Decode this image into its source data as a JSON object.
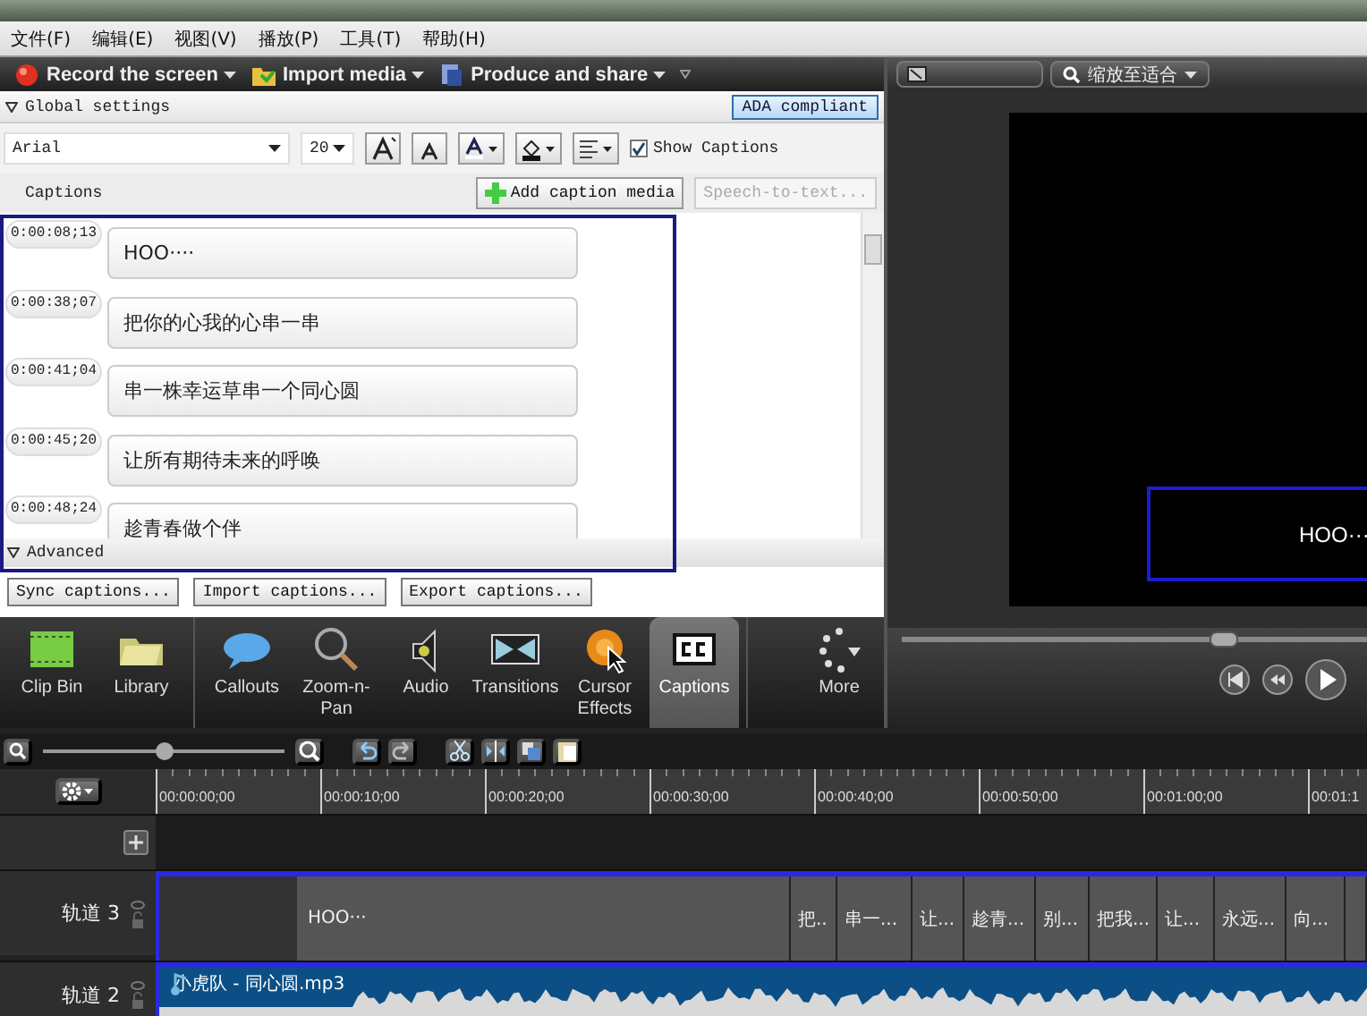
{
  "menu": [
    "文件(F)",
    "编辑(E)",
    "视图(V)",
    "播放(P)",
    "工具(T)",
    "帮助(H)"
  ],
  "toolbar": [
    {
      "label": "Record the screen",
      "kind": "record"
    },
    {
      "label": "Import media",
      "kind": "import"
    },
    {
      "label": "Produce and share",
      "kind": "produce"
    }
  ],
  "caption_panel": {
    "global_settings": "Global settings",
    "ada_button": "ADA compliant",
    "font": "Arial",
    "font_size": "20",
    "show_captions": {
      "label": "Show Captions",
      "checked": true
    },
    "captions_title": "Captions",
    "actions": [
      {
        "label": "Add caption media",
        "disabled": false
      },
      {
        "label": "Speech-to-text...",
        "disabled": true
      }
    ],
    "captions": [
      {
        "time": "0:00:08;13",
        "text": "HOO····"
      },
      {
        "time": "0:00:38;07",
        "text": "把你的心我的心串一串"
      },
      {
        "time": "0:00:41;04",
        "text": "串一株幸运草串一个同心圆"
      },
      {
        "time": "0:00:45;20",
        "text": "让所有期待未来的呼唤"
      },
      {
        "time": "0:00:48;24",
        "text": "趁青春做个伴"
      }
    ],
    "advanced": "Advanced",
    "buttons": [
      "Sync captions...",
      "Import captions...",
      "Export captions..."
    ]
  },
  "tabs": [
    {
      "label": "Clip Bin",
      "kind": "clipbin",
      "selected": false
    },
    {
      "label": "Library",
      "kind": "library",
      "selected": false
    },
    {
      "label": "Callouts",
      "kind": "callouts",
      "selected": false
    },
    {
      "label": "Zoom-n-Pan",
      "kind": "zoom",
      "selected": false
    },
    {
      "label": "Audio",
      "kind": "audio",
      "selected": false
    },
    {
      "label": "Transitions",
      "kind": "transitions",
      "selected": false
    },
    {
      "label": "Cursor Effects",
      "kind": "cursor",
      "selected": false
    },
    {
      "label": "Captions",
      "kind": "captions",
      "selected": true
    },
    {
      "label": "More",
      "kind": "more",
      "selected": false
    }
  ],
  "preview": {
    "zoom_menu": "缩放至适合",
    "caption_text": "HOO···",
    "scrubber": {
      "level": 0.69
    }
  },
  "timeline": {
    "zoom": {
      "level": 0.5
    },
    "ticks": [
      "00:00:00;00",
      "00:00:10;00",
      "00:00:20;00",
      "00:00:30;00",
      "00:00:40;00",
      "00:00:50;00",
      "00:01:00;00",
      "00:01:1"
    ],
    "tracks": [
      {
        "name": "轨道 3",
        "kind": "captions",
        "clips": [
          "HOO···",
          "把..",
          "串一...",
          "让...",
          "趁青...",
          "别...",
          "把我...",
          "让...",
          "永远...",
          "向..."
        ]
      },
      {
        "name": "轨道 2",
        "kind": "audio",
        "clips": [
          "小虎队 - 同心圆.mp3"
        ]
      }
    ]
  }
}
